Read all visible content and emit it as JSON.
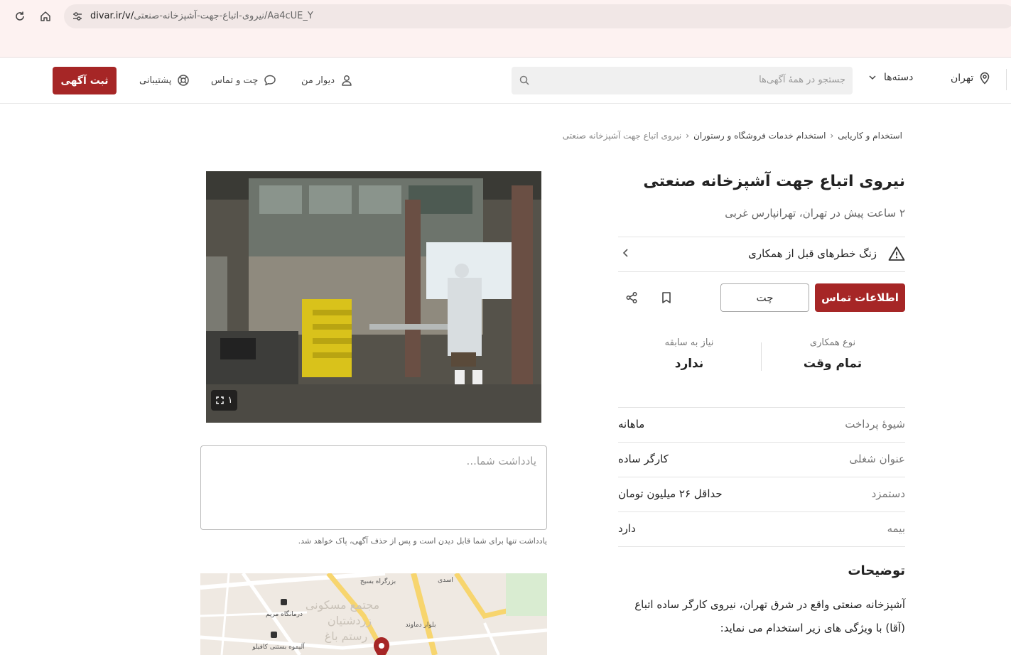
{
  "browser": {
    "url_domain": "divar.ir/v/",
    "url_path": "نیروی-اتباع-جهت-آشپزخانه-صنعتی/Aa4cUE_Y"
  },
  "nav": {
    "post_ad": "ثبت آگهی",
    "support": "پشتیبانی",
    "chat": "چت و تماس",
    "my_divar": "دیوار من",
    "search_placeholder": "جستجو در همهٔ آگهی‌ها",
    "categories": "دسته‌ها",
    "city": "تهران"
  },
  "breadcrumb": {
    "items": [
      "استخدام و کاریابی",
      "استخدام خدمات فروشگاه و رستوران",
      "نیروی اتباع جهت آشپزخانه صنعتی"
    ]
  },
  "ad": {
    "title": "نیروی اتباع جهت آشپزخانه صنعتی",
    "subtitle": "۲ ساعت پیش در تهران، تهرانپارس غربی",
    "warning": "زنگ خطرهای قبل از همکاری",
    "contact_button": "اطلاعات تماس",
    "chat_button": "چت",
    "stats": [
      {
        "label": "نوع همکاری",
        "value": "تمام وقت"
      },
      {
        "label": "نیاز به سابقه",
        "value": "ندارد"
      }
    ],
    "attributes": [
      {
        "label": "شیوهٔ پرداخت",
        "value": "ماهانه"
      },
      {
        "label": "عنوان شغلی",
        "value": "کارگر ساده"
      },
      {
        "label": "دستمزد",
        "value": "حداقل ۲۶ میلیون تومان"
      },
      {
        "label": "بیمه",
        "value": "دارد"
      }
    ],
    "description_title": "توضیحات",
    "description_line1": "آشپزخانه صنعتی واقع در شرق تهران، نیروی کارگر ساده اتباع",
    "description_line2": "(آقا) با ویژگی های زیر استخدام می نماید:"
  },
  "gallery": {
    "counter": "۱"
  },
  "note": {
    "placeholder": "یادداشت شما...",
    "hint": "یادداشت تنها برای شما قابل دیدن است و پس از حذف آگهی، پاک خواهد شد."
  },
  "map": {
    "labels": [
      "مجتمع مسکونی",
      "زردشتیان",
      "رستم باغ",
      "درمانگاه مریم",
      "آلیموه بستنی کافیلو",
      "بزرگراه بسیج",
      "اسدی",
      "بلوار دماوند"
    ]
  },
  "colors": {
    "accent": "#a62626",
    "browser_bg": "#fdf2f1"
  }
}
